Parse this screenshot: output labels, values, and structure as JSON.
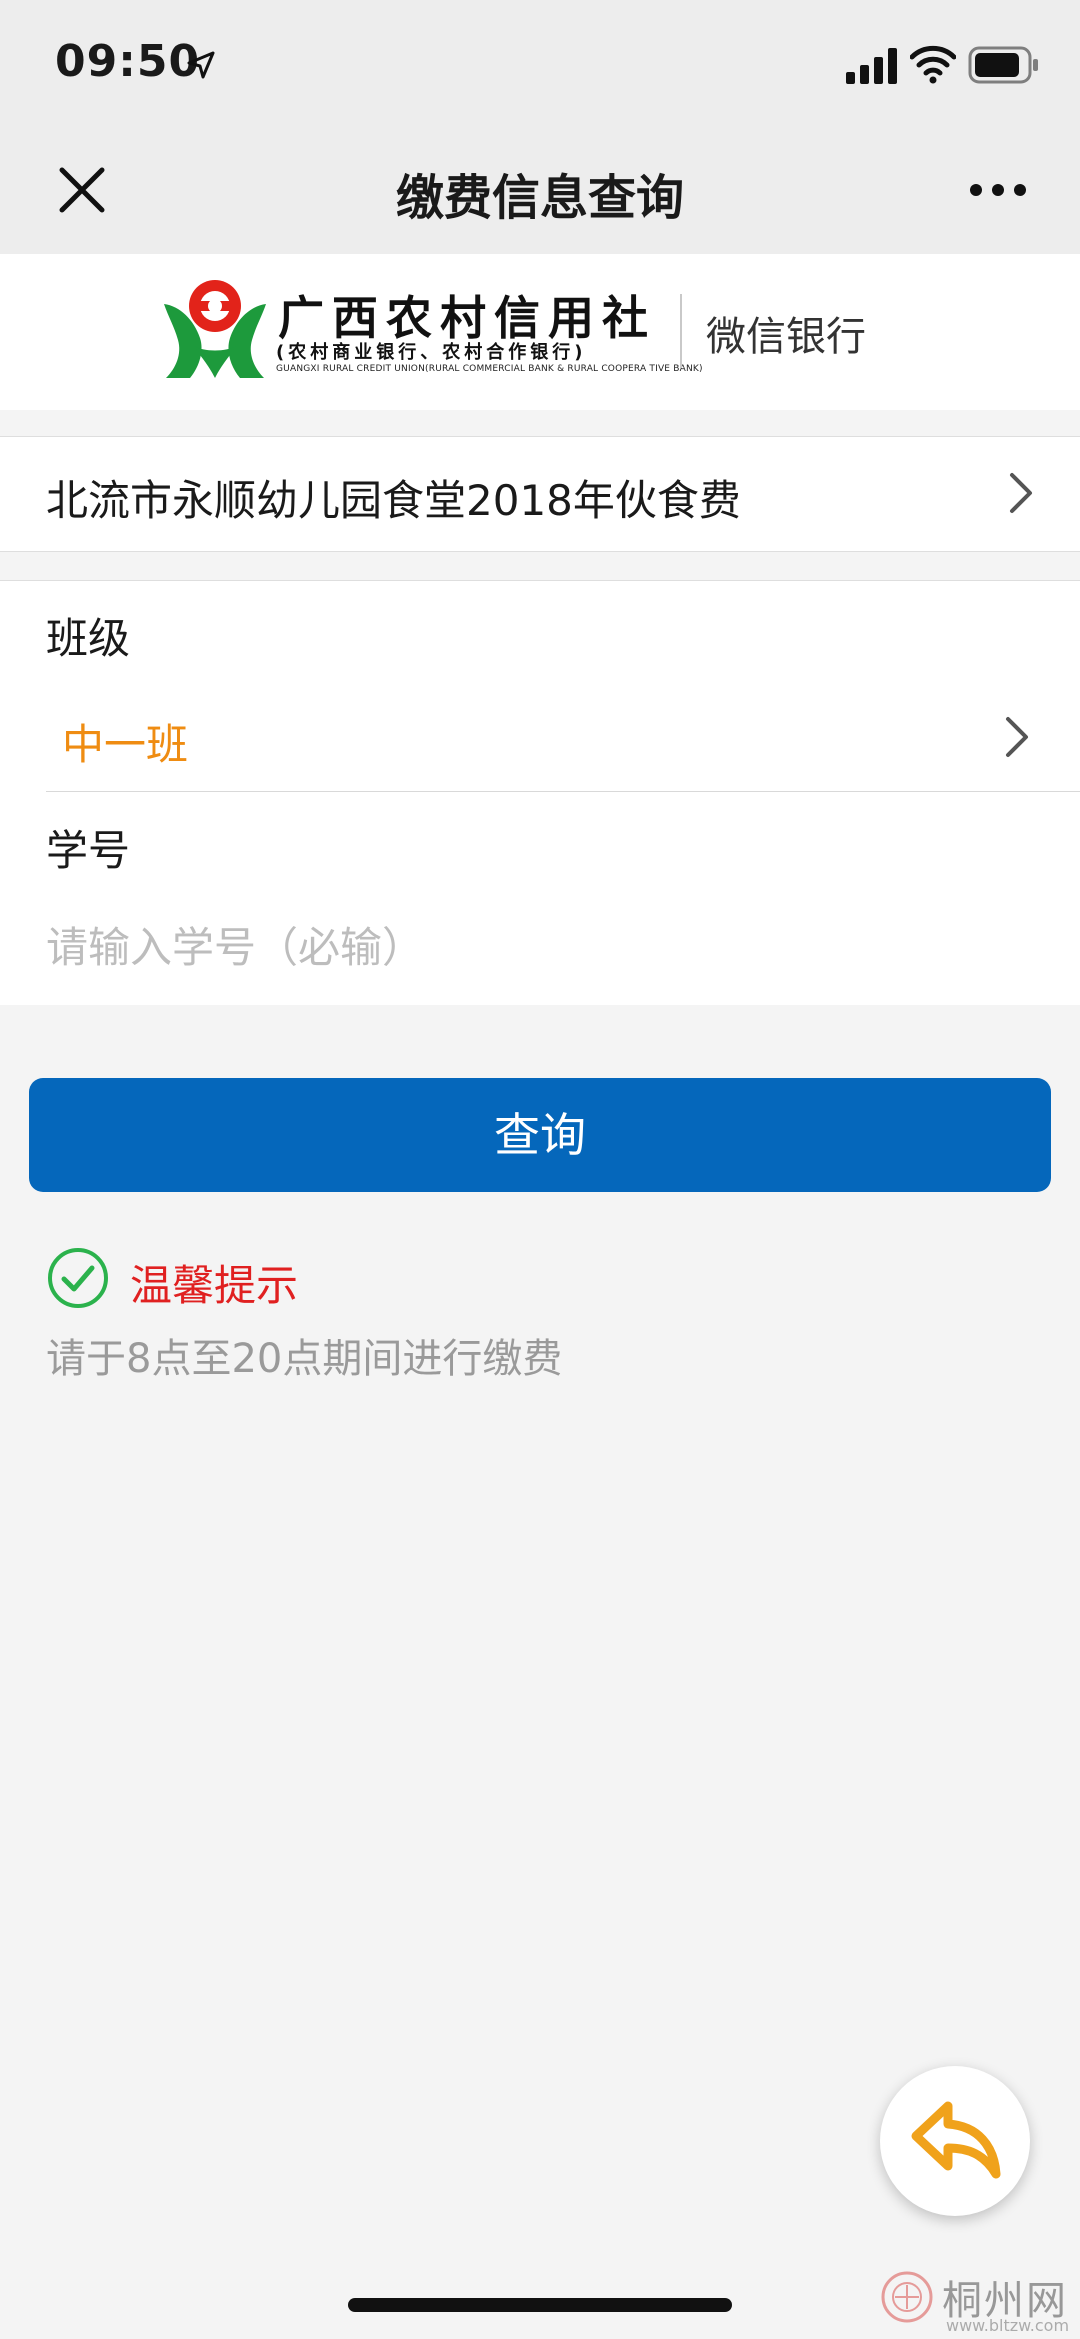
{
  "status_bar": {
    "time": "09:50",
    "icons": [
      "location-arrow-icon",
      "cellular-signal-icon",
      "wifi-icon",
      "battery-icon"
    ]
  },
  "nav": {
    "title": "缴费信息查询",
    "close_icon": "close-icon",
    "more_icon": "more-icon"
  },
  "banner": {
    "bank_name": "广西农村信用社",
    "bank_sub": "(农村商业银行、农村合作银行)",
    "bank_en": "GUANGXI RURAL CREDIT UNION(RURAL COMMERCIAL BANK & RURAL COOPERA TIVE BANK)",
    "channel": "微信银行",
    "logo_colors": {
      "green": "#1d9a3c",
      "red": "#e2231a"
    }
  },
  "payment_item": {
    "label": "北流市永顺幼儿园食堂2018年伙食费"
  },
  "form": {
    "class_label": "班级",
    "class_value": "中一班",
    "student_id_label": "学号",
    "student_id_value": "",
    "student_id_placeholder": "请输入学号（必输）"
  },
  "query_button": {
    "label": "查询",
    "color": "#0567bb"
  },
  "tip": {
    "title": "温馨提示",
    "text": "请于8点至20点期间进行缴费",
    "icon": "check-circle-icon"
  },
  "fab": {
    "icon": "reply-arrow-icon",
    "color": "#f0a21b"
  },
  "watermark": {
    "name": "桐州网",
    "url": "www.bltzw.com"
  },
  "accent_colors": {
    "orange": "#ef8c12",
    "red": "#e02020",
    "blue": "#0567bb",
    "check_green": "#2bb24c"
  }
}
